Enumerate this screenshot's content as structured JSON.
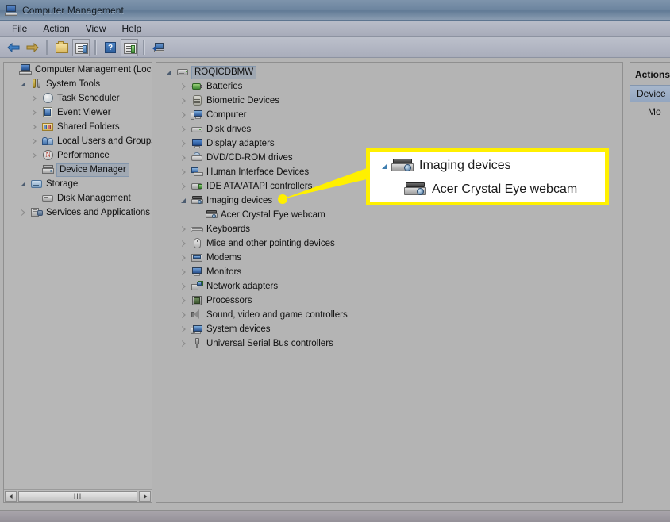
{
  "window": {
    "title": "Computer Management",
    "title_icon": "computer-management-icon"
  },
  "menu": {
    "items": [
      {
        "label": "File"
      },
      {
        "label": "Action"
      },
      {
        "label": "View"
      },
      {
        "label": "Help"
      }
    ]
  },
  "toolbar": {
    "buttons": [
      {
        "name": "back-button",
        "icon": "back-arrow-icon"
      },
      {
        "name": "forward-button",
        "icon": "forward-arrow-icon"
      },
      {
        "name": "up-one-level-button",
        "icon": "folder-up-icon"
      },
      {
        "name": "show-hide-console-tree-button",
        "icon": "console-tree-icon"
      },
      {
        "name": "help-button",
        "icon": "help-question-icon"
      },
      {
        "name": "show-hide-action-pane-button",
        "icon": "action-pane-icon"
      },
      {
        "name": "scan-for-hardware-changes-button",
        "icon": "scan-hardware-icon"
      }
    ]
  },
  "console_tree": {
    "items": [
      {
        "label": "Computer Management (Local",
        "icon": "computer-management-icon",
        "indent": 0,
        "expander": "none",
        "selected": false
      },
      {
        "label": "System Tools",
        "icon": "system-tools-icon",
        "indent": 1,
        "expander": "open",
        "selected": false
      },
      {
        "label": "Task Scheduler",
        "icon": "clock-icon",
        "indent": 2,
        "expander": "closed",
        "selected": false
      },
      {
        "label": "Event Viewer",
        "icon": "event-viewer-icon",
        "indent": 2,
        "expander": "closed",
        "selected": false
      },
      {
        "label": "Shared Folders",
        "icon": "shared-folders-icon",
        "indent": 2,
        "expander": "closed",
        "selected": false
      },
      {
        "label": "Local Users and Groups",
        "icon": "users-groups-icon",
        "indent": 2,
        "expander": "closed",
        "selected": false
      },
      {
        "label": "Performance",
        "icon": "performance-icon",
        "indent": 2,
        "expander": "closed",
        "selected": false
      },
      {
        "label": "Device Manager",
        "icon": "device-manager-icon",
        "indent": 2,
        "expander": "none",
        "selected": true
      },
      {
        "label": "Storage",
        "icon": "storage-icon",
        "indent": 1,
        "expander": "open",
        "selected": false
      },
      {
        "label": "Disk Management",
        "icon": "disk-management-icon",
        "indent": 2,
        "expander": "none",
        "selected": false
      },
      {
        "label": "Services and Applications",
        "icon": "services-applications-icon",
        "indent": 1,
        "expander": "closed",
        "selected": false
      }
    ]
  },
  "device_tree": {
    "items": [
      {
        "label": "ROQICDBMW",
        "icon": "server-icon",
        "indent": 0,
        "expander": "open",
        "selected": true
      },
      {
        "label": "Batteries",
        "icon": "battery-icon",
        "indent": 1,
        "expander": "closed",
        "selected": false
      },
      {
        "label": "Biometric Devices",
        "icon": "fingerprint-icon",
        "indent": 1,
        "expander": "closed",
        "selected": false
      },
      {
        "label": "Computer",
        "icon": "computer-icon",
        "indent": 1,
        "expander": "closed",
        "selected": false
      },
      {
        "label": "Disk drives",
        "icon": "disk-drive-icon",
        "indent": 1,
        "expander": "closed",
        "selected": false
      },
      {
        "label": "Display adapters",
        "icon": "display-adapter-icon",
        "indent": 1,
        "expander": "closed",
        "selected": false
      },
      {
        "label": "DVD/CD-ROM drives",
        "icon": "dvd-drive-icon",
        "indent": 1,
        "expander": "closed",
        "selected": false
      },
      {
        "label": "Human Interface Devices",
        "icon": "hid-icon",
        "indent": 1,
        "expander": "closed",
        "selected": false
      },
      {
        "label": "IDE ATA/ATAPI controllers",
        "icon": "ide-controller-icon",
        "indent": 1,
        "expander": "closed",
        "selected": false
      },
      {
        "label": "Imaging devices",
        "icon": "imaging-device-icon",
        "indent": 1,
        "expander": "open",
        "selected": false
      },
      {
        "label": "Acer Crystal Eye webcam",
        "icon": "webcam-icon",
        "indent": 2,
        "expander": "none",
        "selected": false
      },
      {
        "label": "Keyboards",
        "icon": "keyboard-icon",
        "indent": 1,
        "expander": "closed",
        "selected": false
      },
      {
        "label": "Mice and other pointing devices",
        "icon": "mouse-icon",
        "indent": 1,
        "expander": "closed",
        "selected": false
      },
      {
        "label": "Modems",
        "icon": "modem-icon",
        "indent": 1,
        "expander": "closed",
        "selected": false
      },
      {
        "label": "Monitors",
        "icon": "monitor-icon",
        "indent": 1,
        "expander": "closed",
        "selected": false
      },
      {
        "label": "Network adapters",
        "icon": "network-adapter-icon",
        "indent": 1,
        "expander": "closed",
        "selected": false
      },
      {
        "label": "Processors",
        "icon": "processor-icon",
        "indent": 1,
        "expander": "closed",
        "selected": false
      },
      {
        "label": "Sound, video and game controllers",
        "icon": "sound-controller-icon",
        "indent": 1,
        "expander": "closed",
        "selected": false
      },
      {
        "label": "System devices",
        "icon": "system-device-icon",
        "indent": 1,
        "expander": "closed",
        "selected": false
      },
      {
        "label": "Universal Serial Bus controllers",
        "icon": "usb-controller-icon",
        "indent": 1,
        "expander": "closed",
        "selected": false
      }
    ]
  },
  "actions_pane": {
    "title": "Actions",
    "selected_item": "Device ",
    "more_actions": "Mo"
  },
  "callout": {
    "border_color": "#fff000",
    "row1_label": "Imaging devices",
    "row2_label": "Acer Crystal Eye webcam",
    "row1_icon": "imaging-device-icon",
    "row2_icon": "webcam-icon"
  },
  "scrollbar": {
    "grip": "III"
  },
  "colors": {
    "titlebar": "#6e86a0",
    "window_bg": "#b4b4b4",
    "selection": "#93a6c0",
    "highlight_yellow": "#fff000"
  }
}
